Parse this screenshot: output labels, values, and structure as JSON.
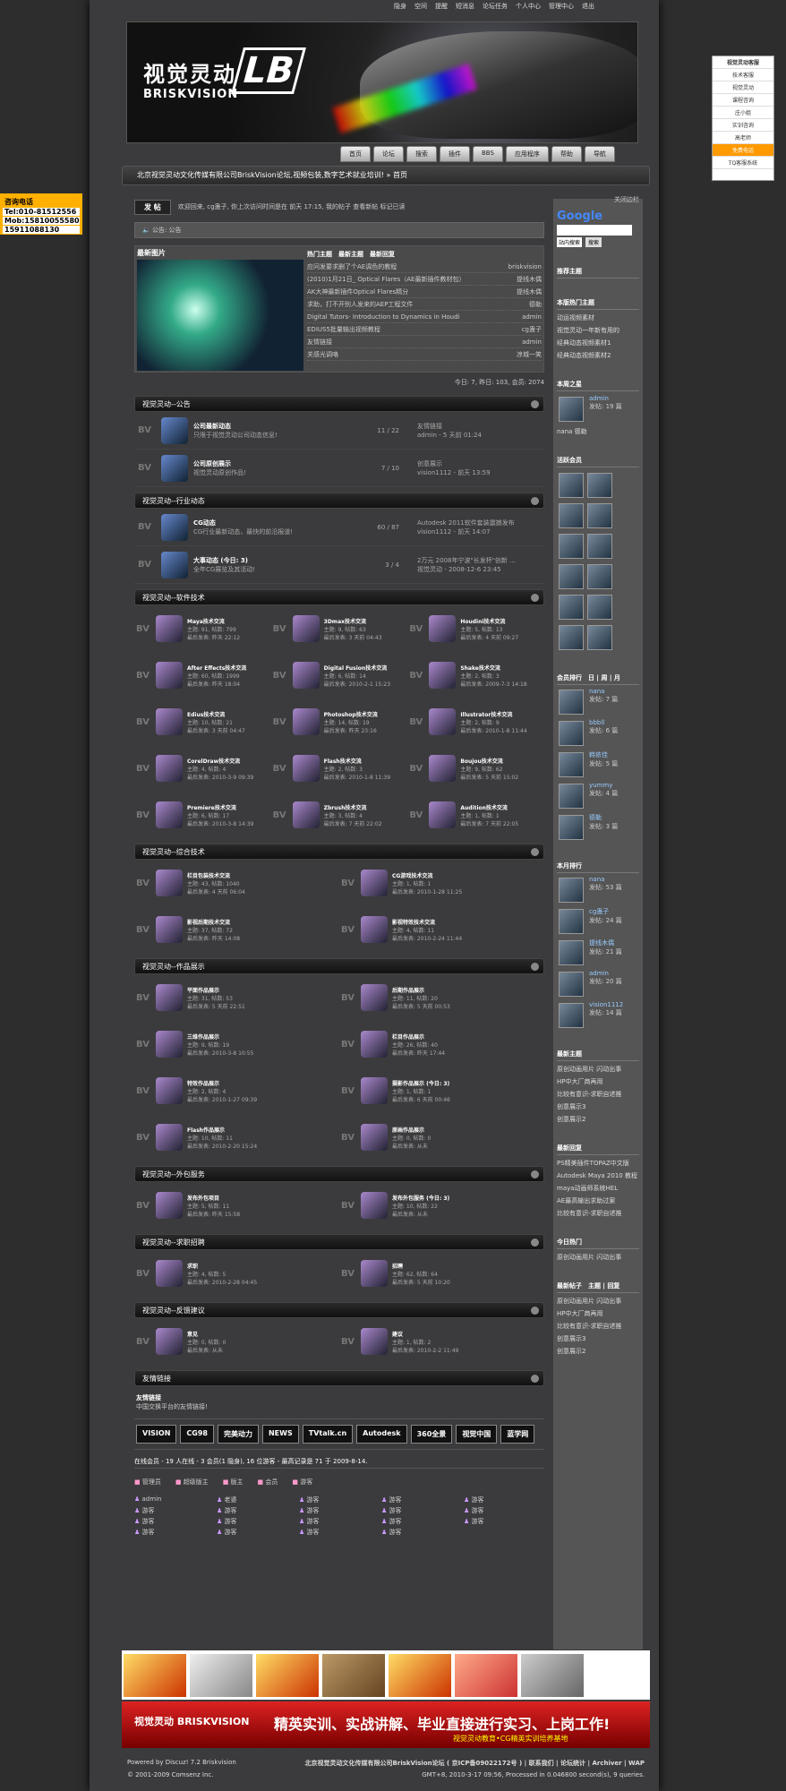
{
  "topbar": [
    "隐身",
    "空间",
    "提醒",
    "短消息",
    "论坛任务",
    "个人中心",
    "管理中心",
    "退出"
  ],
  "banner": {
    "cn": "视觉灵动",
    "en": "BRISKVISION",
    "mark": "LB"
  },
  "nav": [
    "首页",
    "论坛",
    "搜索",
    "插件",
    "BBS",
    "应用程序",
    "帮助",
    "导航"
  ],
  "crumb": "北京视觉灵动文化传媒有限公司BriskVision论坛,视频包装,数字艺术就业培训! » 首页",
  "left_ad": {
    "title": "咨询电话",
    "tel": "Tel:010-81512556",
    "mob1": "Mob:15810055580",
    "mob2": "15911088130"
  },
  "right_qq": {
    "title": "视觉灵动客服",
    "items": [
      "技术客服",
      "视觉灵动",
      "课程咨询",
      "庄小姐",
      "实训咨询",
      "高老师",
      "免费电话",
      "TQ客服系统"
    ]
  },
  "post_btn": "发 帖",
  "welcome": "欢迎回来, cg蛊子, 你上次访问时间是在 前天 17:15, 我的帖子 查看新帖 标记已读",
  "close_side": "关闭边栏",
  "notice_label": "公告:",
  "notice_text": "公告",
  "hot": {
    "tab_img": "最新图片",
    "tabs": [
      "热门主题",
      "最新主题",
      "最新回复"
    ],
    "rows": [
      [
        "应问发要求删了个AE调色的教程",
        "briskvision"
      ],
      [
        "(2010)1月21日_ Optical Flares（AE最新插件教材包）",
        "提线木偶"
      ],
      [
        "AK大神最新插件Optical Flares精分",
        "提线木偶"
      ],
      [
        "求助，打不开别人发来的AEP工程文件",
        "德勒"
      ],
      [
        "Digital Tutors- Introduction to Dynamics in Houdi",
        "admin"
      ],
      [
        "EDIUS5批量输出视频教程",
        "cg蛊子"
      ],
      [
        "友情链接",
        "admin"
      ],
      [
        "关感光调咯",
        "凉城一笑"
      ]
    ]
  },
  "stats": "今日: 7, 昨日: 103, 会员: 2074",
  "sections": [
    {
      "title": "视觉灵动--公告",
      "rows": [
        [
          "公司最新动态",
          "只限于视觉灵动公司动态信息!",
          "11 / 22",
          "友情链接",
          "admin - 5 天前 01:24"
        ],
        [
          "公司原创展示",
          "视觉灵动原创作品!",
          "7 / 10",
          "创意展示",
          "vision1112 - 前天 13:59"
        ]
      ]
    },
    {
      "title": "视觉灵动--行业动态",
      "rows": [
        [
          "CG动态",
          "CG行业最新动态，最快的前沿报道!",
          "60 / 87",
          "Autodesk 2011软件套装震撼发布",
          "vision1112 - 前天 14:07"
        ],
        [
          "大事动态 (今日: 3)",
          "全年CG展览及其活动!",
          "3 / 4",
          "2万元 2008年宁波\"长发杯\"创新 ...",
          "视觉灵动 - 2008-12-6 23:45"
        ]
      ]
    }
  ],
  "software": {
    "title": "视觉灵动--软件技术",
    "cells": [
      [
        "Maya技术交流",
        "主题: 91, 帖数: 799",
        "最后发表: 昨天 22:12"
      ],
      [
        "3Dmax技术交流",
        "主题: 9, 帖数: 63",
        "最后发表: 3 天前 04:43"
      ],
      [
        "Houdini技术交流",
        "主题: 5, 帖数: 13",
        "最后发表: 4 天前 09:27"
      ],
      [
        "After Effects技术交流",
        "主题: 60, 帖数: 1999",
        "最后发表: 昨天 18:04"
      ],
      [
        "Digital Fusion技术交流",
        "主题: 6, 帖数: 14",
        "最后发表: 2010-2-1 15:23"
      ],
      [
        "Shake技术交流",
        "主题: 2, 帖数: 3",
        "最后发表: 2009-7-3 14:18"
      ],
      [
        "Edius技术交流",
        "主题: 10, 帖数: 21",
        "最后发表: 3 天前 04:47"
      ],
      [
        "Photoshop技术交流",
        "主题: 14, 帖数: 19",
        "最后发表: 昨天 23:16"
      ],
      [
        "Illustrator技术交流",
        "主题: 2, 帖数: 9",
        "最后发表: 2010-1-8 11:44"
      ],
      [
        "CorelDraw技术交流",
        "主题: 4, 帖数: 4",
        "最后发表: 2010-3-9 09:39"
      ],
      [
        "Flash技术交流",
        "主题: 2, 帖数: 3",
        "最后发表: 2010-1-8 11:39"
      ],
      [
        "Boujou技术交流",
        "主题: 9, 帖数: 62",
        "最后发表: 5 天前 15:02"
      ],
      [
        "Premiere技术交流",
        "主题: 6, 帖数: 17",
        "最后发表: 2010-3-8 14:39"
      ],
      [
        "Zbrush技术交流",
        "主题: 3, 帖数: 4",
        "最后发表: 7 天前 22:02"
      ],
      [
        "Audition技术交流",
        "主题: 1, 帖数: 1",
        "最后发表: 7 天前 22:05"
      ]
    ]
  },
  "two_col": [
    {
      "title": "视觉灵动--综合技术",
      "cells": [
        [
          "栏目包装技术交流",
          "主题: 43, 帖数: 1040",
          "最后发表: 4 天前 06:04"
        ],
        [
          "CG游戏技术交流",
          "主题: 1, 帖数: 1",
          "最后发表: 2010-1-28 11:25"
        ],
        [
          "影视后期技术交流",
          "主题: 37, 帖数: 72",
          "最后发表: 昨天 14:08"
        ],
        [
          "影视特效技术交流",
          "主题: 4, 帖数: 11",
          "最后发表: 2010-2-24 11:44"
        ]
      ]
    },
    {
      "title": "视觉灵动--作品展示",
      "cells": [
        [
          "平面作品展示",
          "主题: 31, 帖数: 53",
          "最后发表: 5 天前 22:51"
        ],
        [
          "后期作品展示",
          "主题: 11, 帖数: 20",
          "最后发表: 5 天前 00:53"
        ],
        [
          "三维作品展示",
          "主题: 9, 帖数: 19",
          "最后发表: 2010-3-8 10:55"
        ],
        [
          "栏目作品展示",
          "主题: 26, 帖数: 40",
          "最后发表: 昨天 17:44"
        ],
        [
          "特效作品展示",
          "主题: 2, 帖数: 4",
          "最后发表: 2010-1-27 09:39"
        ],
        [
          "摄影作品展示 (今日: 3)",
          "主题: 1, 帖数: 1",
          "最后发表: 6 天前 00:46"
        ],
        [
          "Flash作品展示",
          "主题: 10, 帖数: 11",
          "最后发表: 2010-2-20 15:24"
        ],
        [
          "原画作品展示",
          "主题: 0, 帖数: 0",
          "最后发表: 从未"
        ]
      ]
    },
    {
      "title": "视觉灵动--外包服务",
      "cells": [
        [
          "发布外包项目",
          "主题: 5, 帖数: 11",
          "最后发表: 昨天 15:58"
        ],
        [
          "发布外包服务 (今日: 3)",
          "主题: 10, 帖数: 22",
          "最后发表: 从未"
        ]
      ]
    },
    {
      "title": "视觉灵动--求职招聘",
      "cells": [
        [
          "求职",
          "主题: 4, 帖数: 5",
          "最后发表: 2010-2-28 04:45"
        ],
        [
          "招聘",
          "主题: 62, 帖数: 64",
          "最后发表: 5 天前 10:20"
        ]
      ]
    },
    {
      "title": "视觉灵动--反馈建议",
      "cells": [
        [
          "意见",
          "主题: 0, 帖数: 0",
          "最后发表: 从未"
        ],
        [
          "建议",
          "主题: 1, 帖数: 2",
          "最后发表: 2010-2-2 11:49"
        ]
      ]
    }
  ],
  "links": {
    "title": "友情链接",
    "name": "友情链接",
    "desc": "中国交换平台的友情链接!",
    "logos": [
      "VISION",
      "CG98",
      "完美动力",
      "NEWS",
      "TVtalk.cn",
      "Autodesk",
      "360全景",
      "视觉中国",
      "蓝学网"
    ]
  },
  "online": {
    "title": "在线会员 - 19 人在线 - 3 会员(1 隐身), 16 位游客 - 最高记录是 71 于 2009-8-14.",
    "legend": [
      "管理员",
      "超级版主",
      "版主",
      "会员",
      "游客"
    ],
    "users": [
      "admin",
      "老婆",
      "游客",
      "游客",
      "游客",
      "游客",
      "游客",
      "游客",
      "游客",
      "游客",
      "游客",
      "游客",
      "游客",
      "游客",
      "游客",
      "游客",
      "游客",
      "游客",
      "游客"
    ]
  },
  "sidebar": {
    "google": "Google",
    "search_opt": "站内搜索",
    "search_btn": "搜索",
    "hot_title": "推荐主题",
    "month_hot": "本版热门主题",
    "month_list": [
      "动运视频素材",
      "视觉灵动一年新有用的",
      "经典动态视频素材1",
      "经典动态视频素材2"
    ],
    "weekstar": "本周之星",
    "star1": "admin",
    "star1_sub": "发帖: 19 篇",
    "star2": "nana 德勒",
    "active": "活跃会员",
    "rank_title": "会员排行",
    "rank_tabs": [
      "日",
      "周",
      "月"
    ],
    "rank": [
      [
        "nana",
        "发帖: 7 篇"
      ],
      [
        "bbbll",
        "发帖: 6 篇"
      ],
      [
        "韩依佳",
        "发帖: 5 篇"
      ],
      [
        "yummy",
        "发帖: 4 篇"
      ],
      [
        "德勒",
        "发帖: 3 篇"
      ]
    ],
    "month_rank": "本月排行",
    "mrank": [
      [
        "nana",
        "发帖: 53 篇"
      ],
      [
        "cg蛊子",
        "发帖: 24 篇"
      ],
      [
        "提线木偶",
        "发帖: 21 篇"
      ],
      [
        "admin",
        "发帖: 20 篇"
      ],
      [
        "vision1112",
        "发帖: 14 篇"
      ]
    ],
    "new_title": "最新主题",
    "new_list": [
      "原创动画用片 闪动出事",
      "HP中大厂商再用",
      "比较有意识-求职自述推",
      "创意展示3",
      "创意展示2"
    ],
    "reply_title": "最新回复",
    "reply_list": [
      "PS精美插件TOPAZ中文版",
      "Autodesk Maya 2010 教程",
      "maya动画师系统HEL",
      "AE最高输出求助过案",
      "比较有意识-求职自述推"
    ],
    "today_title": "今日热门",
    "today_list": [
      "原创动画用片 闪动出事"
    ],
    "newpost_title": "最新帖子",
    "newpost_tabs": [
      "主题",
      "回复"
    ],
    "newpost_list": [
      "原创动画用片 闪动出事",
      "HP中大厂商再用",
      "比较有意识-求职自述推",
      "创意展示3",
      "创意展示2"
    ]
  },
  "red_banner": {
    "logo": "视觉灵动 BRISKVISION",
    "text": "精英实训、实战讲解、毕业直接进行实习、上岗工作!",
    "sub": "视觉灵动教育•CG精英实训培养基地"
  },
  "footer": {
    "left1": "Powered by Discuz! 7.2 Briskvision",
    "left2": "© 2001-2009 Comsenz Inc.",
    "right1": "北京视觉灵动文化传媒有限公司BriskVision论坛 ( 京ICP备09022172号 ) | 联系我们 | 论坛统计 | Archiver | WAP",
    "right2": "GMT+8, 2010-3-17 09:56, Processed in 0.046800 second(s), 9 queries."
  }
}
